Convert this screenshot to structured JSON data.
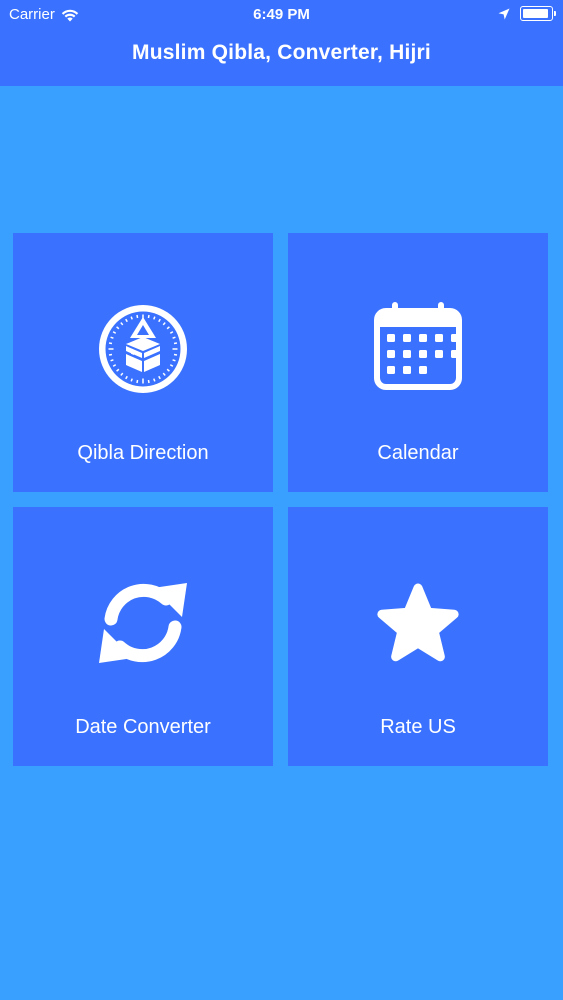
{
  "status_bar": {
    "carrier": "Carrier",
    "time": "6:49 PM",
    "battery_level": 0.95
  },
  "header": {
    "title": "Muslim Qibla, Converter, Hijri"
  },
  "tiles": [
    {
      "label": "Qibla Direction",
      "icon": "qibla-compass-icon"
    },
    {
      "label": "Calendar",
      "icon": "calendar-icon"
    },
    {
      "label": "Date Converter",
      "icon": "refresh-icon"
    },
    {
      "label": "Rate US",
      "icon": "star-icon"
    }
  ],
  "colors": {
    "background": "#3aa0ff",
    "bar": "#3a72ff",
    "tile": "#3a72ff",
    "foreground": "#ffffff"
  }
}
